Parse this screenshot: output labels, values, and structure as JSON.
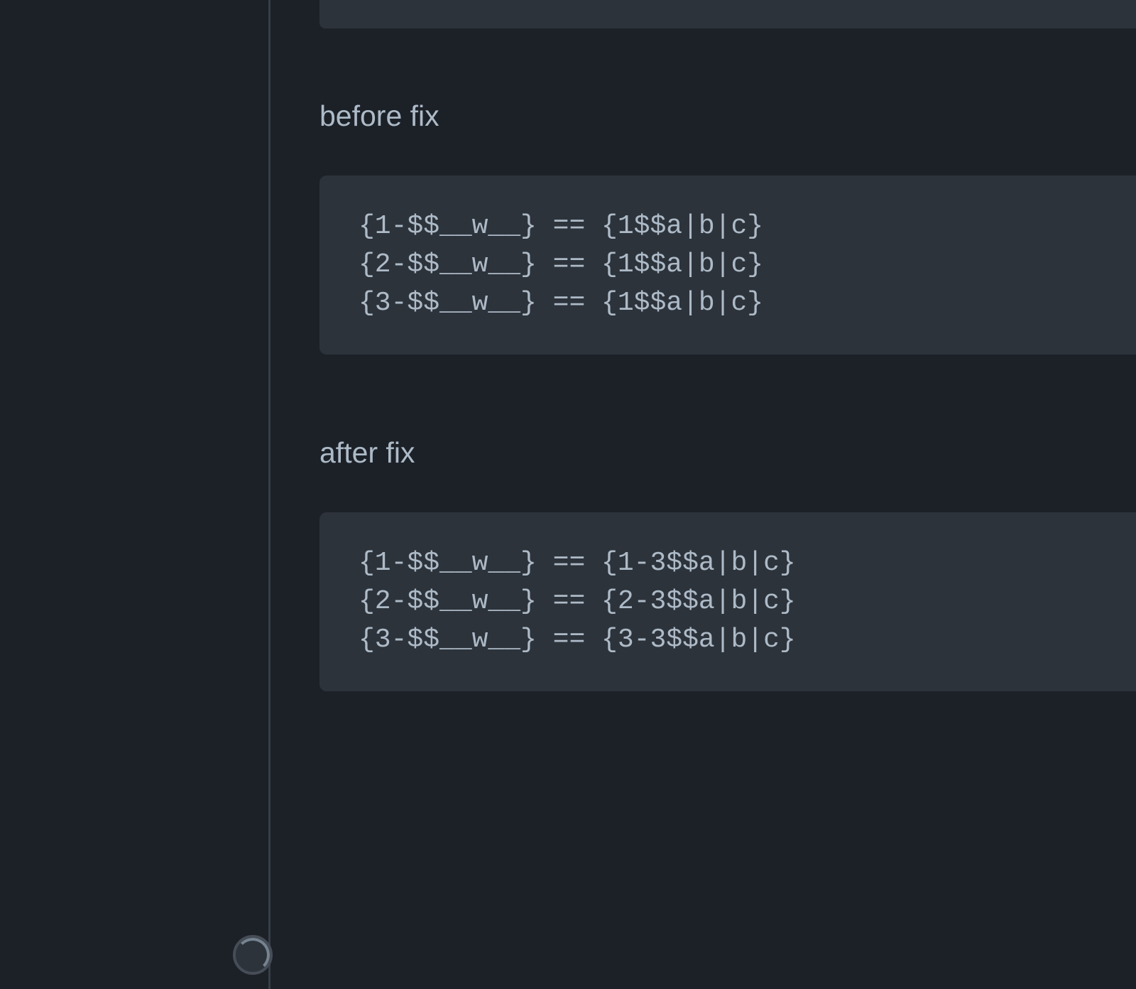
{
  "sections": {
    "before": {
      "label": "before fix",
      "lines": [
        "{1-$$__w__} == {1$$a|b|c}",
        "{2-$$__w__} == {1$$a|b|c}",
        "{3-$$__w__} == {1$$a|b|c}"
      ]
    },
    "after": {
      "label": "after fix",
      "lines": [
        "{1-$$__w__} == {1-3$$a|b|c}",
        "{2-$$__w__} == {2-3$$a|b|c}",
        "{3-$$__w__} == {3-3$$a|b|c}"
      ]
    }
  }
}
